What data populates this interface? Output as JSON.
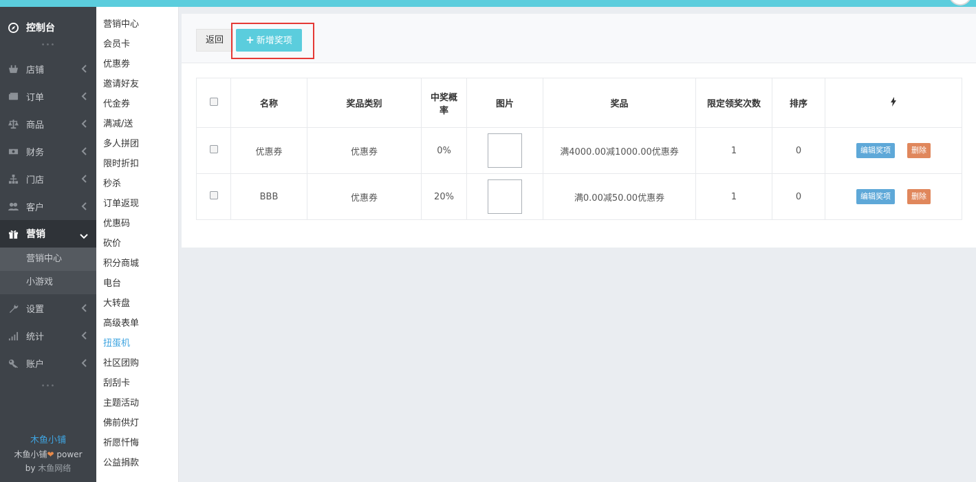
{
  "nav": {
    "home": "控制台",
    "items": [
      {
        "label": "店铺",
        "icon": "basket-icon"
      },
      {
        "label": "订单",
        "icon": "card-icon"
      },
      {
        "label": "商品",
        "icon": "scale-icon"
      },
      {
        "label": "财务",
        "icon": "money-icon"
      },
      {
        "label": "门店",
        "icon": "sitemap-icon"
      },
      {
        "label": "客户",
        "icon": "users-icon"
      }
    ],
    "active": {
      "label": "营销",
      "icon": "gift-icon"
    },
    "sub_items": [
      "营销中心",
      "小游戏"
    ],
    "items_after": [
      {
        "label": "设置",
        "icon": "wrench-icon"
      },
      {
        "label": "统计",
        "icon": "signal-icon"
      },
      {
        "label": "账户",
        "icon": "key-icon"
      }
    ]
  },
  "footer": {
    "brand": "木鱼小铺",
    "power_name": "木鱼小铺",
    "power_word": "power",
    "by": "by",
    "by_name": "木鱼网络"
  },
  "subnav": {
    "items": [
      "营销中心",
      "会员卡",
      "优惠劵",
      "邀请好友",
      "代金券",
      "满减/送",
      "多人拼团",
      "限时折扣",
      "秒杀",
      "订单返现",
      "优惠码",
      "砍价",
      "积分商城",
      "电台",
      "大转盘",
      "高级表单",
      "扭蛋机",
      "社区团购",
      "刮刮卡",
      "主题活动",
      "佛前供灯",
      "祈愿忏悔",
      "公益捐款"
    ],
    "current": "扭蛋机"
  },
  "toolbar": {
    "back_label": "返回",
    "add_label": "新增奖项"
  },
  "table": {
    "headers": [
      "名称",
      "奖品类别",
      "中奖概率",
      "图片",
      "奖品",
      "限定领奖次数",
      "排序"
    ],
    "rows": [
      {
        "name": "优惠券",
        "category": "优惠券",
        "probability": "0%",
        "prize": "满4000.00减1000.00优惠券",
        "limit": "1",
        "sort": "0"
      },
      {
        "name": "BBB",
        "category": "优惠券",
        "probability": "20%",
        "prize": "满0.00减50.00优惠券",
        "limit": "1",
        "sort": "0"
      }
    ],
    "edit_label": "编辑奖项",
    "delete_label": "删除"
  },
  "colors": {
    "accent": "#5bcddd",
    "sidebar": "#3e4349",
    "link": "#3ea4e0",
    "edit": "#5ea8d8",
    "delete": "#e0875c",
    "highlight": "#e53935"
  }
}
